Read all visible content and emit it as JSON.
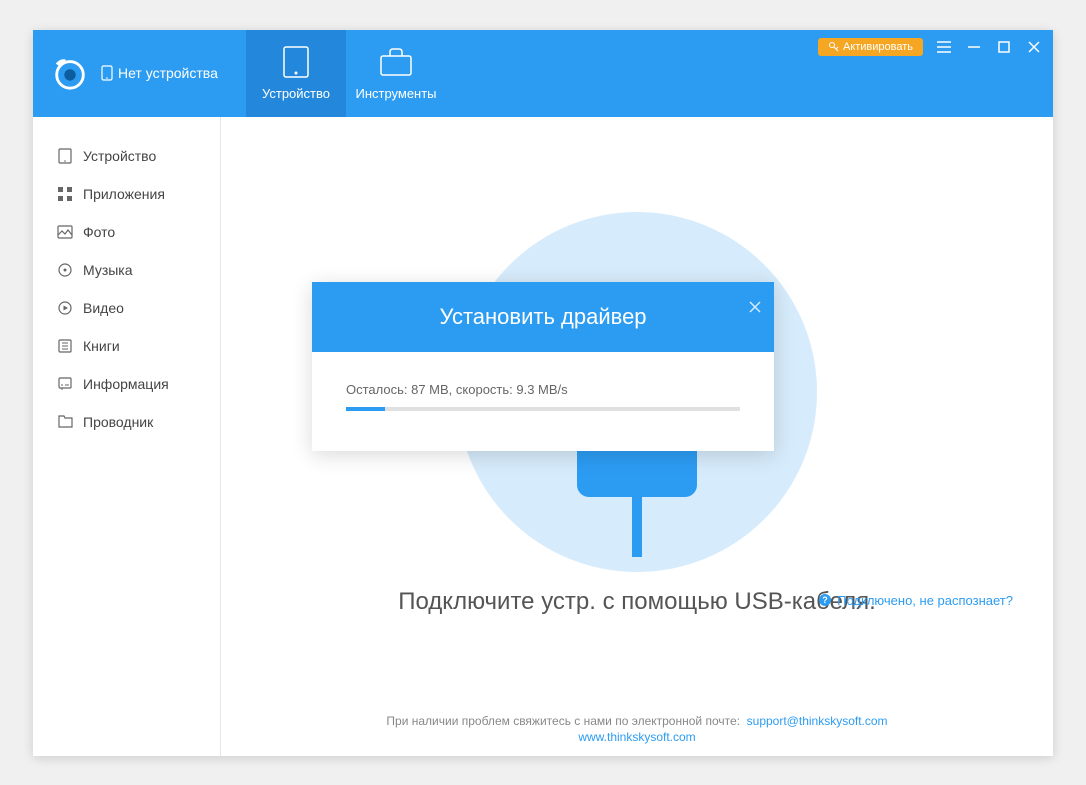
{
  "header": {
    "no_device_label": "Нет устройства",
    "tabs": [
      {
        "label": "Устройство",
        "icon": "device"
      },
      {
        "label": "Инструменты",
        "icon": "tools"
      }
    ],
    "activate_label": "Активировать"
  },
  "sidebar": {
    "items": [
      {
        "label": "Устройство",
        "icon": "device"
      },
      {
        "label": "Приложения",
        "icon": "apps"
      },
      {
        "label": "Фото",
        "icon": "photo"
      },
      {
        "label": "Музыка",
        "icon": "music"
      },
      {
        "label": "Видео",
        "icon": "video"
      },
      {
        "label": "Книги",
        "icon": "books"
      },
      {
        "label": "Информация",
        "icon": "info"
      },
      {
        "label": "Проводник",
        "icon": "folder"
      }
    ]
  },
  "main": {
    "connect_prompt": "Подключите устр. с помощью USB-кабеля.",
    "help_link": "Подключено, не распознает?",
    "support_text": "При наличии проблем свяжитесь с нами по электронной почте:",
    "support_email": "support@thinkskysoft.com",
    "website": "www.thinkskysoft.com"
  },
  "modal": {
    "title": "Установить драйвер",
    "progress_text": "Осталось: 87 МВ, скорость: 9.3 MB/s",
    "progress_percent": 10
  }
}
